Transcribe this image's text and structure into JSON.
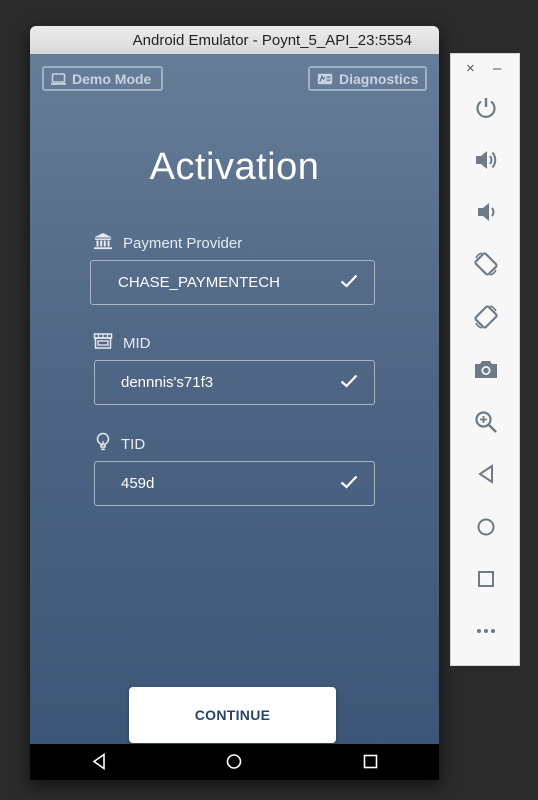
{
  "window": {
    "title": "Android Emulator - Poynt_5_API_23:5554"
  },
  "app": {
    "demo_mode_label": "Demo Mode",
    "diagnostics_label": "Diagnostics",
    "heading": "Activation",
    "fields": [
      {
        "label": "Payment Provider",
        "value": "CHASE_PAYMENTECH",
        "icon": "bank-icon",
        "valid": true
      },
      {
        "label": "MID",
        "value": "dennnis's71f3",
        "icon": "store-icon",
        "valid": true
      },
      {
        "label": "TID",
        "value": "459d",
        "icon": "lightbulb-icon",
        "valid": true
      }
    ],
    "continue_label": "CONTINUE"
  },
  "navbar": {
    "buttons": [
      "back-icon",
      "home-icon",
      "recents-icon"
    ]
  },
  "side_panel": {
    "top": {
      "close": "×",
      "minimize": "–"
    },
    "buttons": [
      "power-icon",
      "volume-up-icon",
      "volume-down-icon",
      "rotate-left-icon",
      "rotate-right-icon",
      "camera-icon",
      "zoom-icon",
      "back-icon",
      "home-icon",
      "overview-icon",
      "more-icon"
    ]
  },
  "colors": {
    "screen_top": "#667d98",
    "screen_bottom": "#3d5677",
    "button_text": "#2a4466",
    "side_icon": "#6e7a86"
  }
}
